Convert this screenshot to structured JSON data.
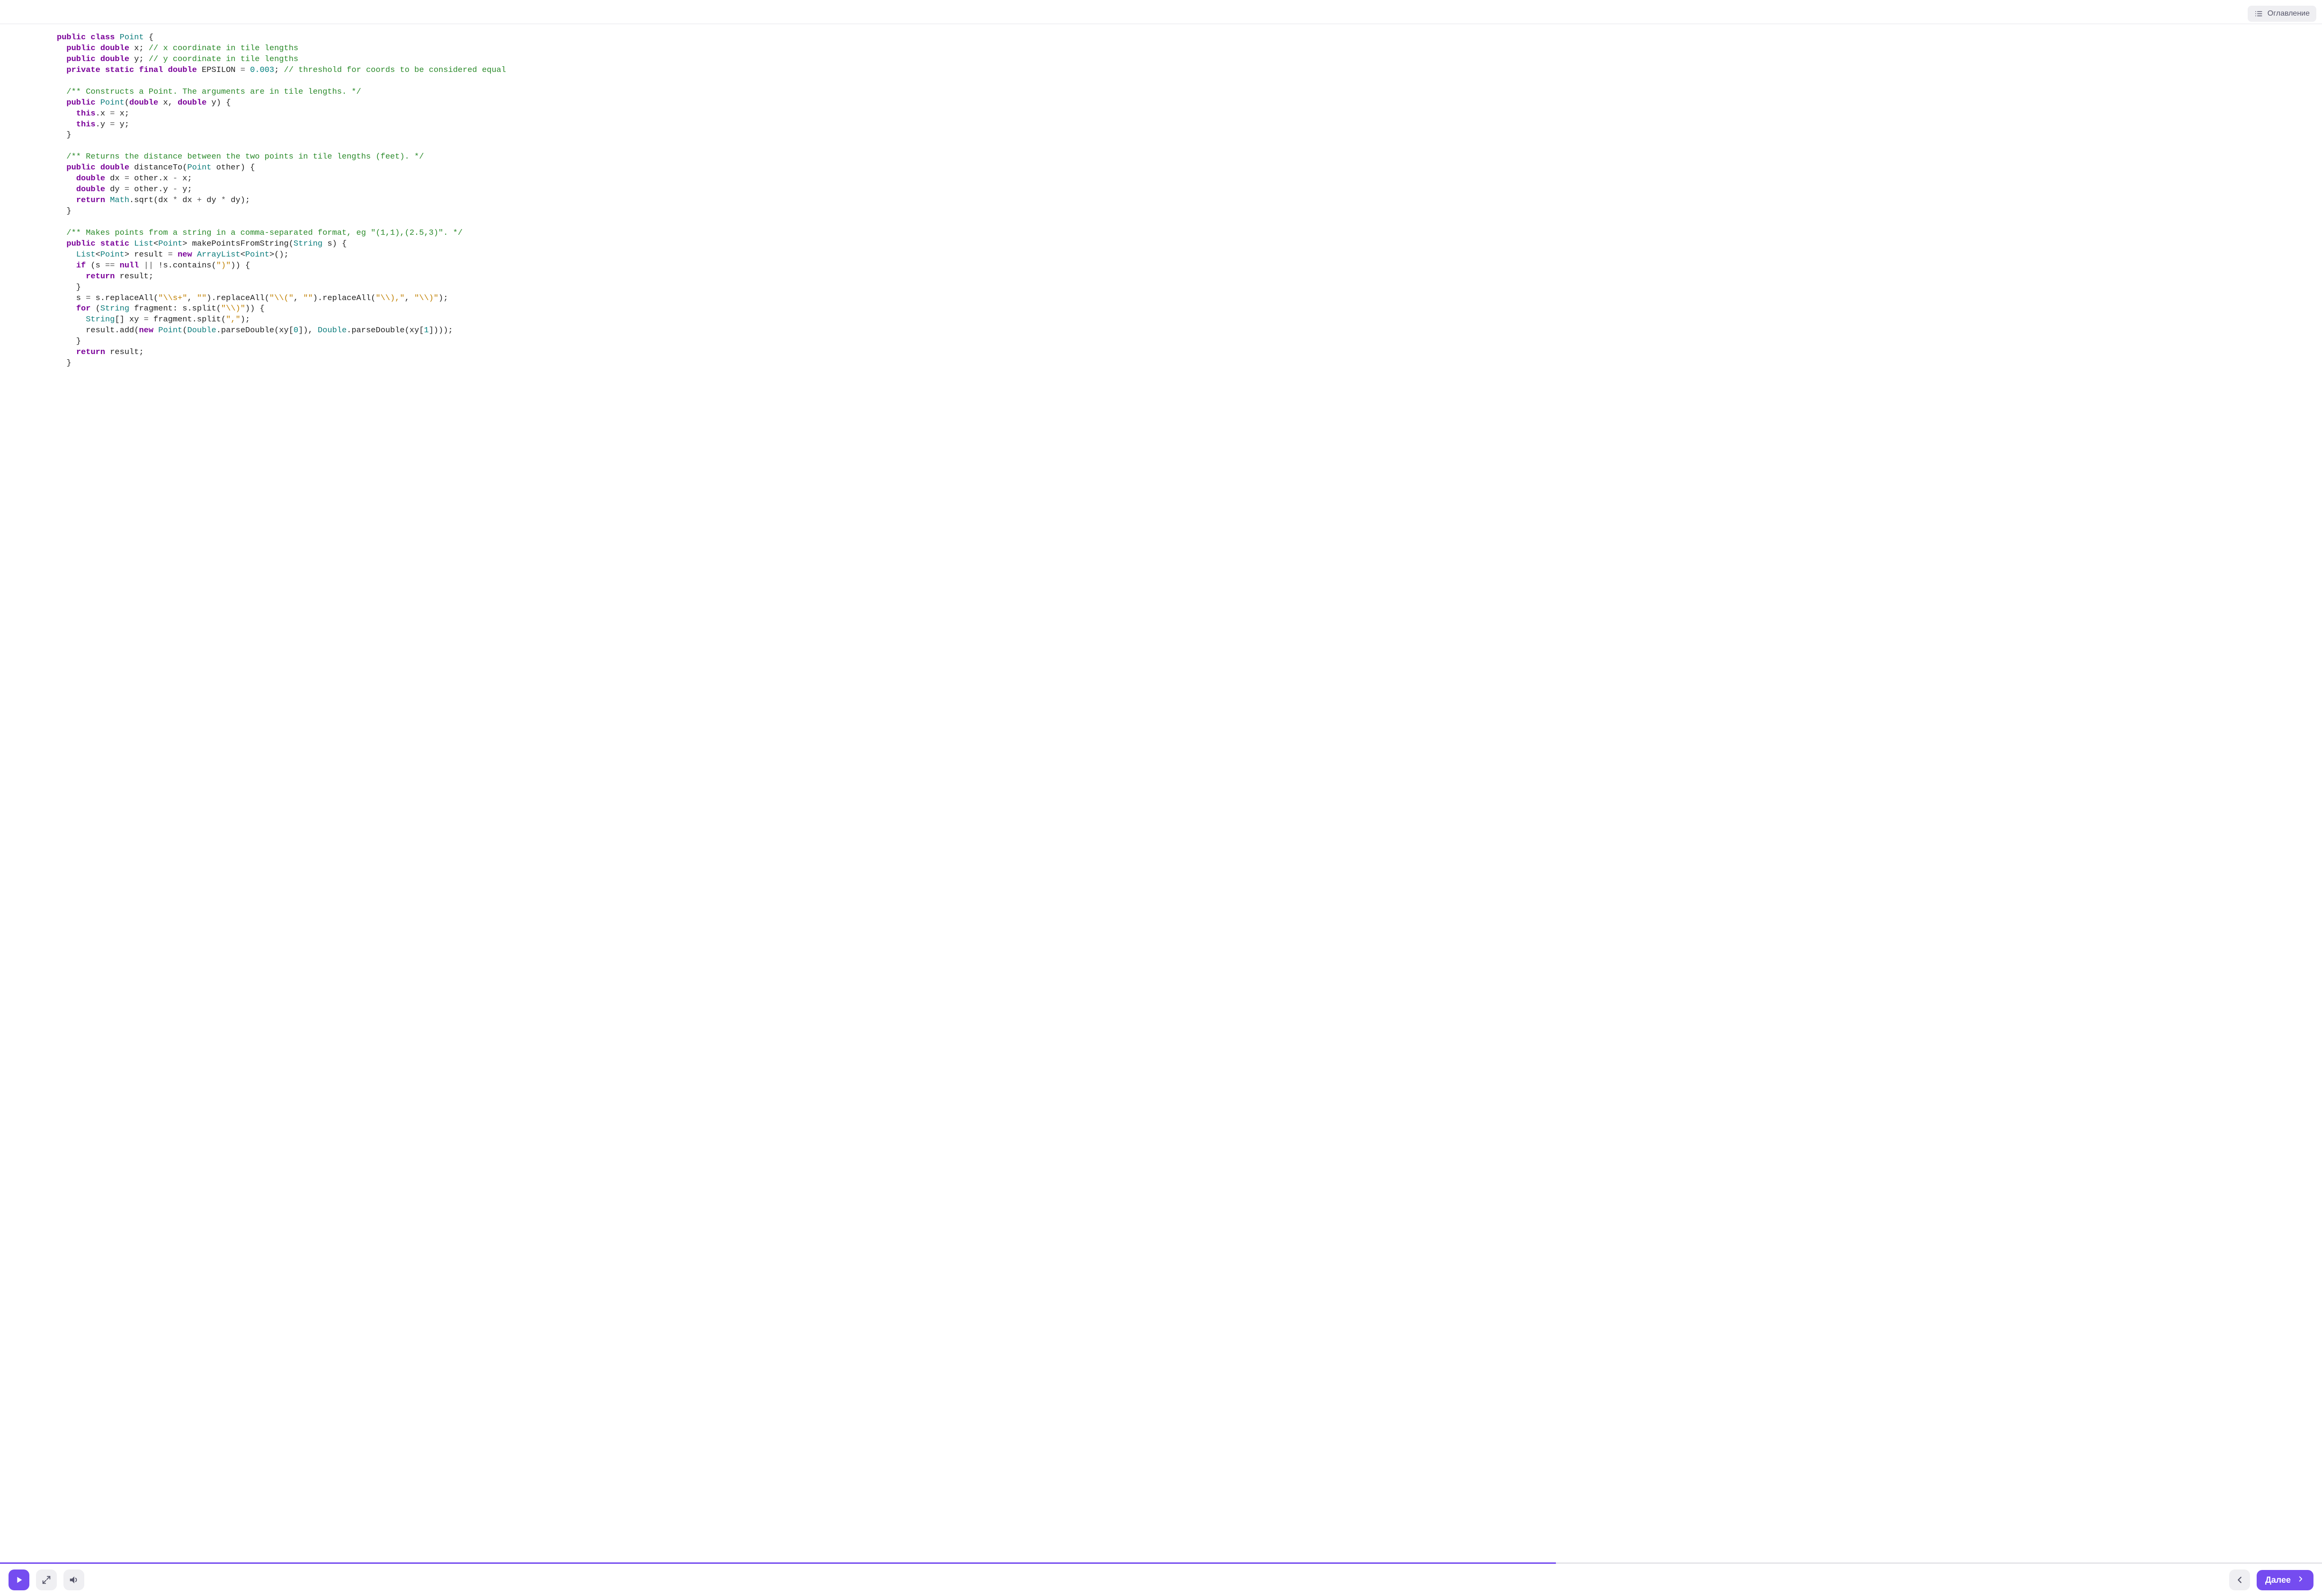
{
  "header": {
    "toc_label": "Оглавление"
  },
  "footer": {
    "next_label": "Далее",
    "progress_percent": 67
  },
  "code": {
    "lines": [
      [
        {
          "c": "kw",
          "t": "public"
        },
        {
          "c": "",
          "t": " "
        },
        {
          "c": "kw",
          "t": "class"
        },
        {
          "c": "",
          "t": " "
        },
        {
          "c": "type",
          "t": "Point"
        },
        {
          "c": "",
          "t": " {"
        }
      ],
      [
        {
          "c": "",
          "t": "  "
        },
        {
          "c": "kw",
          "t": "public"
        },
        {
          "c": "",
          "t": " "
        },
        {
          "c": "kw",
          "t": "double"
        },
        {
          "c": "",
          "t": " x; "
        },
        {
          "c": "comment",
          "t": "// x coordinate in tile lengths"
        }
      ],
      [
        {
          "c": "",
          "t": "  "
        },
        {
          "c": "kw",
          "t": "public"
        },
        {
          "c": "",
          "t": " "
        },
        {
          "c": "kw",
          "t": "double"
        },
        {
          "c": "",
          "t": " y; "
        },
        {
          "c": "comment",
          "t": "// y coordinate in tile lengths"
        }
      ],
      [
        {
          "c": "",
          "t": "  "
        },
        {
          "c": "kw",
          "t": "private"
        },
        {
          "c": "",
          "t": " "
        },
        {
          "c": "kw",
          "t": "static"
        },
        {
          "c": "",
          "t": " "
        },
        {
          "c": "kw",
          "t": "final"
        },
        {
          "c": "",
          "t": " "
        },
        {
          "c": "kw",
          "t": "double"
        },
        {
          "c": "",
          "t": " EPSILON "
        },
        {
          "c": "op",
          "t": "="
        },
        {
          "c": "",
          "t": " "
        },
        {
          "c": "num",
          "t": "0.003"
        },
        {
          "c": "",
          "t": "; "
        },
        {
          "c": "comment",
          "t": "// threshold for coords to be considered equal"
        }
      ],
      [
        {
          "c": "",
          "t": ""
        }
      ],
      [
        {
          "c": "",
          "t": "  "
        },
        {
          "c": "comment",
          "t": "/** Constructs a Point. The arguments are in tile lengths. */"
        }
      ],
      [
        {
          "c": "",
          "t": "  "
        },
        {
          "c": "kw",
          "t": "public"
        },
        {
          "c": "",
          "t": " "
        },
        {
          "c": "type",
          "t": "Point"
        },
        {
          "c": "",
          "t": "("
        },
        {
          "c": "kw",
          "t": "double"
        },
        {
          "c": "",
          "t": " x, "
        },
        {
          "c": "kw",
          "t": "double"
        },
        {
          "c": "",
          "t": " y) {"
        }
      ],
      [
        {
          "c": "",
          "t": "    "
        },
        {
          "c": "kw",
          "t": "this"
        },
        {
          "c": "",
          "t": ".x "
        },
        {
          "c": "op",
          "t": "="
        },
        {
          "c": "",
          "t": " x;"
        }
      ],
      [
        {
          "c": "",
          "t": "    "
        },
        {
          "c": "kw",
          "t": "this"
        },
        {
          "c": "",
          "t": ".y "
        },
        {
          "c": "op",
          "t": "="
        },
        {
          "c": "",
          "t": " y;"
        }
      ],
      [
        {
          "c": "",
          "t": "  }"
        }
      ],
      [
        {
          "c": "",
          "t": ""
        }
      ],
      [
        {
          "c": "",
          "t": "  "
        },
        {
          "c": "comment",
          "t": "/** Returns the distance between the two points in tile lengths (feet). */"
        }
      ],
      [
        {
          "c": "",
          "t": "  "
        },
        {
          "c": "kw",
          "t": "public"
        },
        {
          "c": "",
          "t": " "
        },
        {
          "c": "kw",
          "t": "double"
        },
        {
          "c": "",
          "t": " distanceTo("
        },
        {
          "c": "type",
          "t": "Point"
        },
        {
          "c": "",
          "t": " other) {"
        }
      ],
      [
        {
          "c": "",
          "t": "    "
        },
        {
          "c": "kw",
          "t": "double"
        },
        {
          "c": "",
          "t": " dx "
        },
        {
          "c": "op",
          "t": "="
        },
        {
          "c": "",
          "t": " other.x "
        },
        {
          "c": "op",
          "t": "-"
        },
        {
          "c": "",
          "t": " x;"
        }
      ],
      [
        {
          "c": "",
          "t": "    "
        },
        {
          "c": "kw",
          "t": "double"
        },
        {
          "c": "",
          "t": " dy "
        },
        {
          "c": "op",
          "t": "="
        },
        {
          "c": "",
          "t": " other.y "
        },
        {
          "c": "op",
          "t": "-"
        },
        {
          "c": "",
          "t": " y;"
        }
      ],
      [
        {
          "c": "",
          "t": "    "
        },
        {
          "c": "kw",
          "t": "return"
        },
        {
          "c": "",
          "t": " "
        },
        {
          "c": "type",
          "t": "Math"
        },
        {
          "c": "",
          "t": ".sqrt(dx "
        },
        {
          "c": "op",
          "t": "*"
        },
        {
          "c": "",
          "t": " dx "
        },
        {
          "c": "op",
          "t": "+"
        },
        {
          "c": "",
          "t": " dy "
        },
        {
          "c": "op",
          "t": "*"
        },
        {
          "c": "",
          "t": " dy);"
        }
      ],
      [
        {
          "c": "",
          "t": "  }"
        }
      ],
      [
        {
          "c": "",
          "t": ""
        }
      ],
      [
        {
          "c": "",
          "t": "  "
        },
        {
          "c": "comment",
          "t": "/** Makes points from a string in a comma-separated format, eg \"(1,1),(2.5,3)\". */"
        }
      ],
      [
        {
          "c": "",
          "t": "  "
        },
        {
          "c": "kw",
          "t": "public"
        },
        {
          "c": "",
          "t": " "
        },
        {
          "c": "kw",
          "t": "static"
        },
        {
          "c": "",
          "t": " "
        },
        {
          "c": "type",
          "t": "List"
        },
        {
          "c": "",
          "t": "<"
        },
        {
          "c": "type",
          "t": "Point"
        },
        {
          "c": "",
          "t": "> makePointsFromString("
        },
        {
          "c": "type",
          "t": "String"
        },
        {
          "c": "",
          "t": " s) {"
        }
      ],
      [
        {
          "c": "",
          "t": "    "
        },
        {
          "c": "type",
          "t": "List"
        },
        {
          "c": "",
          "t": "<"
        },
        {
          "c": "type",
          "t": "Point"
        },
        {
          "c": "",
          "t": "> result "
        },
        {
          "c": "op",
          "t": "="
        },
        {
          "c": "",
          "t": " "
        },
        {
          "c": "kw",
          "t": "new"
        },
        {
          "c": "",
          "t": " "
        },
        {
          "c": "type",
          "t": "ArrayList"
        },
        {
          "c": "",
          "t": "<"
        },
        {
          "c": "type",
          "t": "Point"
        },
        {
          "c": "",
          "t": ">();"
        }
      ],
      [
        {
          "c": "",
          "t": "    "
        },
        {
          "c": "kw",
          "t": "if"
        },
        {
          "c": "",
          "t": " (s "
        },
        {
          "c": "op",
          "t": "=="
        },
        {
          "c": "",
          "t": " "
        },
        {
          "c": "kw",
          "t": "null"
        },
        {
          "c": "",
          "t": " "
        },
        {
          "c": "op",
          "t": "||"
        },
        {
          "c": "",
          "t": " !s.contains("
        },
        {
          "c": "str",
          "t": "\")\""
        },
        {
          "c": "",
          "t": ")) {"
        }
      ],
      [
        {
          "c": "",
          "t": "      "
        },
        {
          "c": "kw",
          "t": "return"
        },
        {
          "c": "",
          "t": " result;"
        }
      ],
      [
        {
          "c": "",
          "t": "    }"
        }
      ],
      [
        {
          "c": "",
          "t": "    s "
        },
        {
          "c": "op",
          "t": "="
        },
        {
          "c": "",
          "t": " s.replaceAll("
        },
        {
          "c": "str",
          "t": "\"\\\\s+\""
        },
        {
          "c": "",
          "t": ", "
        },
        {
          "c": "str",
          "t": "\"\""
        },
        {
          "c": "",
          "t": ").replaceAll("
        },
        {
          "c": "str",
          "t": "\"\\\\(\""
        },
        {
          "c": "",
          "t": ", "
        },
        {
          "c": "str",
          "t": "\"\""
        },
        {
          "c": "",
          "t": ").replaceAll("
        },
        {
          "c": "str",
          "t": "\"\\\\),\""
        },
        {
          "c": "",
          "t": ", "
        },
        {
          "c": "str",
          "t": "\"\\\\)\""
        },
        {
          "c": "",
          "t": ");"
        }
      ],
      [
        {
          "c": "",
          "t": "    "
        },
        {
          "c": "kw",
          "t": "for"
        },
        {
          "c": "",
          "t": " ("
        },
        {
          "c": "type",
          "t": "String"
        },
        {
          "c": "",
          "t": " fragment: s.split("
        },
        {
          "c": "str",
          "t": "\"\\\\)\""
        },
        {
          "c": "",
          "t": ")) {"
        }
      ],
      [
        {
          "c": "",
          "t": "      "
        },
        {
          "c": "type",
          "t": "String"
        },
        {
          "c": "",
          "t": "[] xy "
        },
        {
          "c": "op",
          "t": "="
        },
        {
          "c": "",
          "t": " fragment.split("
        },
        {
          "c": "str",
          "t": "\",\""
        },
        {
          "c": "",
          "t": ");"
        }
      ],
      [
        {
          "c": "",
          "t": "      result.add("
        },
        {
          "c": "kw",
          "t": "new"
        },
        {
          "c": "",
          "t": " "
        },
        {
          "c": "type",
          "t": "Point"
        },
        {
          "c": "",
          "t": "("
        },
        {
          "c": "type",
          "t": "Double"
        },
        {
          "c": "",
          "t": ".parseDouble(xy["
        },
        {
          "c": "num",
          "t": "0"
        },
        {
          "c": "",
          "t": "]), "
        },
        {
          "c": "type",
          "t": "Double"
        },
        {
          "c": "",
          "t": ".parseDouble(xy["
        },
        {
          "c": "num",
          "t": "1"
        },
        {
          "c": "",
          "t": "])));"
        }
      ],
      [
        {
          "c": "",
          "t": "    }"
        }
      ],
      [
        {
          "c": "",
          "t": "    "
        },
        {
          "c": "kw",
          "t": "return"
        },
        {
          "c": "",
          "t": " result;"
        }
      ],
      [
        {
          "c": "",
          "t": "  }"
        }
      ]
    ]
  }
}
